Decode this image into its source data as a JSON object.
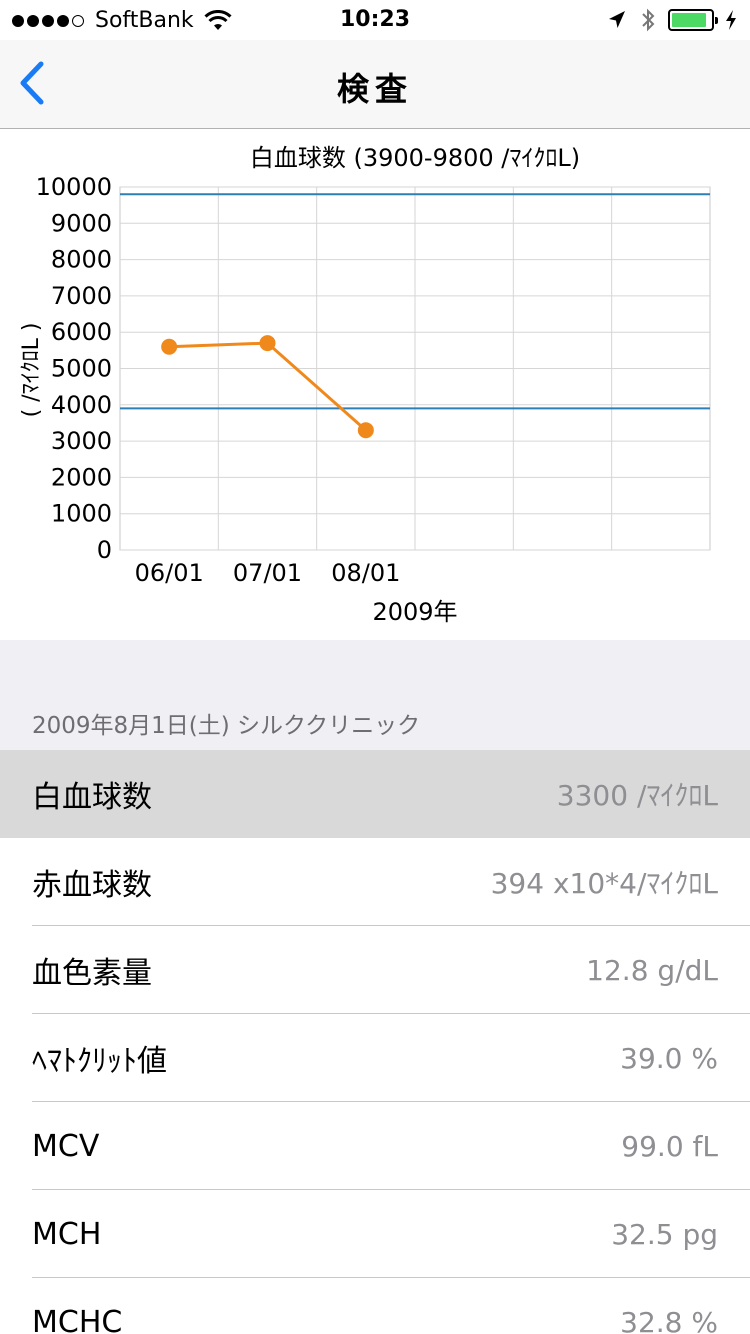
{
  "status": {
    "carrier": "SoftBank",
    "time": "10:23",
    "signal_bars": 4,
    "battery_level": 0.9,
    "battery_color": "#4cd964"
  },
  "nav": {
    "title": "検査",
    "back_icon": "chevron-left-icon",
    "accent": "#1a7cf5"
  },
  "chart_data": {
    "type": "line",
    "title": "白血球数 (3900-9800 /ﾏｲｸﾛL)",
    "ylabel": "( /ﾏｲｸﾛL )",
    "xlabel": "2009年",
    "ylim": [
      0,
      10000
    ],
    "yticks": [
      "0",
      "1000",
      "2000",
      "3000",
      "4000",
      "5000",
      "6000",
      "7000",
      "8000",
      "9000",
      "10000"
    ],
    "x_slots": 6,
    "xticks": [
      "06/01",
      "07/01",
      "08/01"
    ],
    "reference_lines": [
      9800,
      3900
    ],
    "reference_color": "#2f7fb7",
    "series": [
      {
        "color": "#f0891c",
        "values": [
          5600,
          5700,
          3300
        ]
      }
    ]
  },
  "section": {
    "header": "2009年8月1日(土) シルククリニック"
  },
  "rows": [
    {
      "label": "白血球数",
      "value": "3300 /ﾏｲｸﾛL"
    },
    {
      "label": "赤血球数",
      "value": "394 x10*4/ﾏｲｸﾛL"
    },
    {
      "label": "血色素量",
      "value": "12.8 g/dL"
    },
    {
      "label": "ﾍﾏﾄｸﾘｯﾄ値",
      "value": "39.0 %"
    },
    {
      "label": "MCV",
      "value": "99.0 fL"
    },
    {
      "label": "MCH",
      "value": "32.5 pg"
    },
    {
      "label": "MCHC",
      "value": "32.8 %"
    }
  ]
}
